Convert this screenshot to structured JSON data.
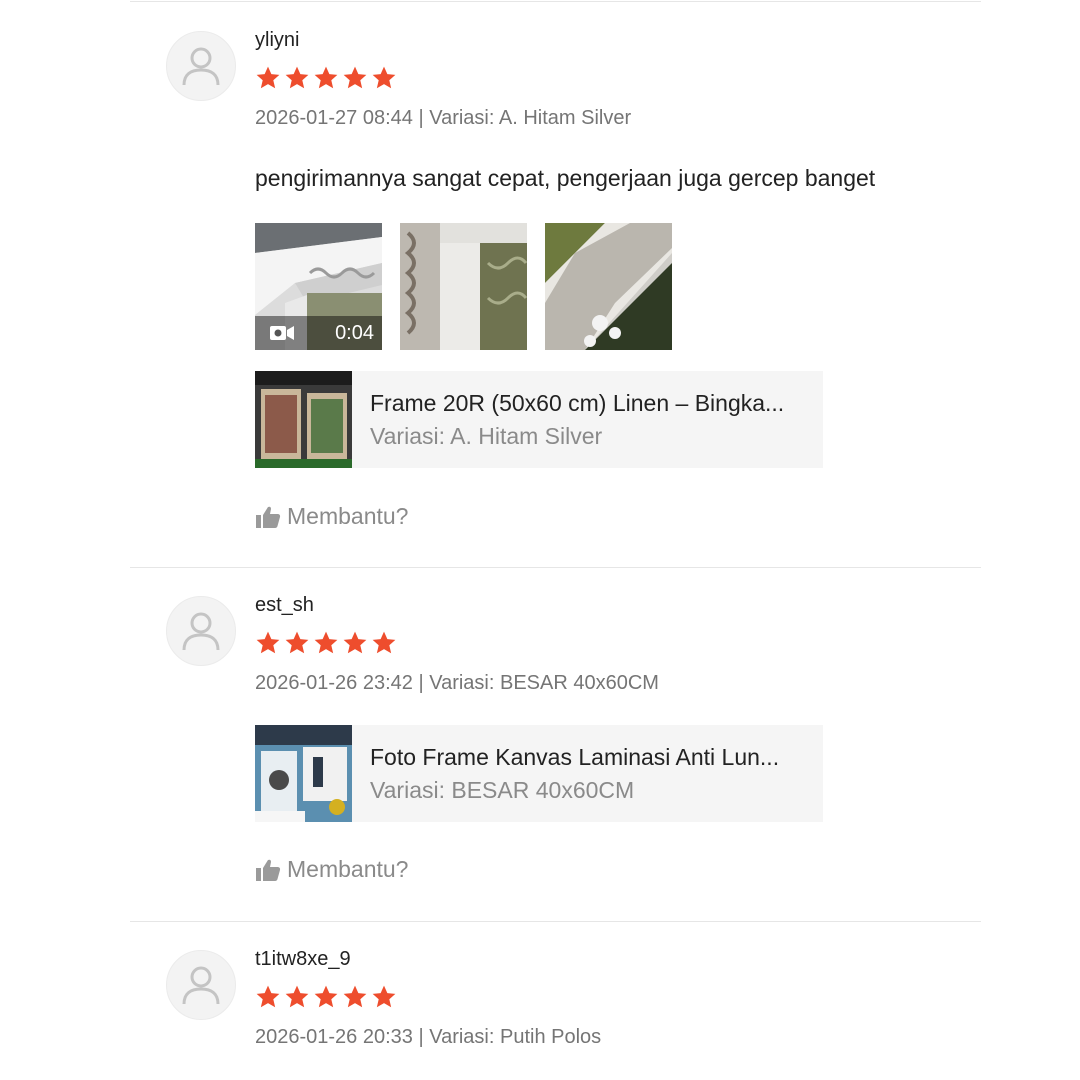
{
  "colors": {
    "star": "#ee4d2d",
    "meta_text": "#757575",
    "divider": "#e6e6e6",
    "product_bg": "#f5f5f5"
  },
  "icons": {
    "avatar": "user-silhouette-icon",
    "star": "star-icon",
    "video": "video-camera-icon",
    "helpful": "thumbs-up-icon"
  },
  "reviews": [
    {
      "username": "yliyni",
      "rating": 5,
      "meta": "2026-01-27 08:44 | Variasi: A. Hitam Silver",
      "comment": "pengirimannya sangat cepat, pengerjaan juga gercep banget",
      "video_duration": "0:04",
      "product": {
        "name": "Frame 20R (50x60 cm) Linen – Bingka...",
        "variant": "Variasi: A. Hitam Silver"
      },
      "helpful_label": "Membantu?"
    },
    {
      "username": "est_sh",
      "rating": 5,
      "meta": "2026-01-26 23:42 | Variasi: BESAR 40x60CM",
      "product": {
        "name": "Foto Frame Kanvas Laminasi Anti Lun...",
        "variant": "Variasi: BESAR 40x60CM"
      },
      "helpful_label": "Membantu?"
    },
    {
      "username": "t1itw8xe_9",
      "rating": 5,
      "meta": "2026-01-26 20:33 | Variasi: Putih Polos"
    }
  ]
}
